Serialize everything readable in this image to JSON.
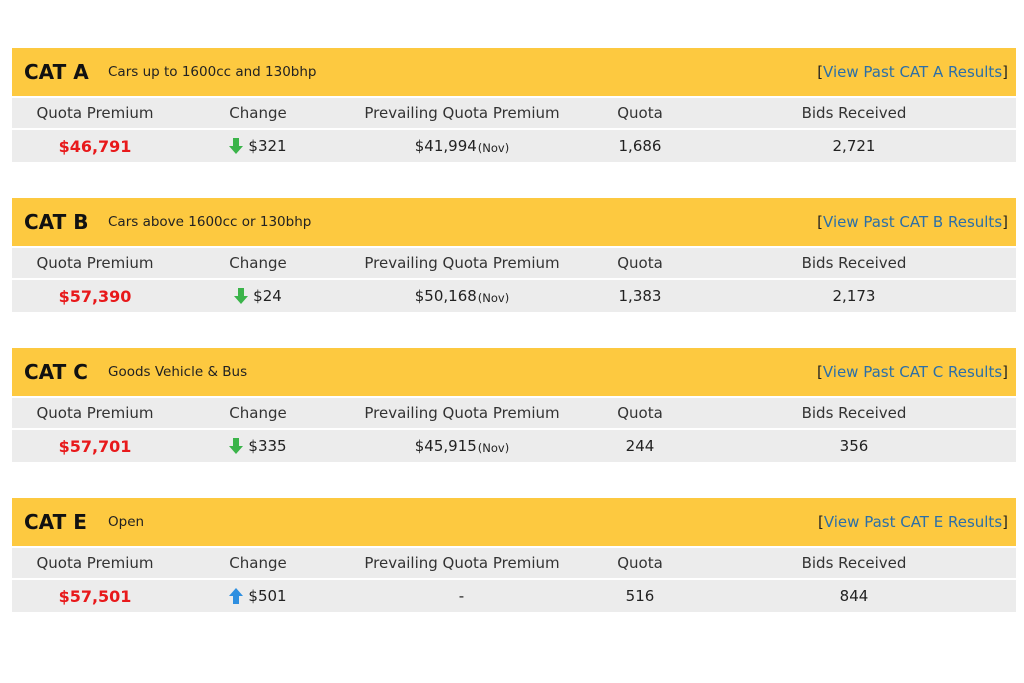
{
  "columns": {
    "quota_premium": "Quota Premium",
    "change": "Change",
    "prevailing": "Prevailing Quota Premium",
    "quota": "Quota",
    "bids": "Bids Received"
  },
  "colors": {
    "header_bg": "#fdc940",
    "row_bg": "#ececec",
    "premium": "#e8191b",
    "down": "#3bb44a",
    "up": "#2e8fe0",
    "link": "#2b6fa8"
  },
  "categories": [
    {
      "name": "CAT A",
      "desc": "Cars up to 1600cc and 130bhp",
      "link": "View Past CAT A Results",
      "premium": "$46,791",
      "change_dir": "down",
      "change_icon": "arrow-down-icon",
      "change": "$321",
      "prevailing": "$41,994",
      "prevailing_suffix": "(Nov)",
      "quota": "1,686",
      "bids": "2,721"
    },
    {
      "name": "CAT B",
      "desc": "Cars above 1600cc or 130bhp",
      "link": "View Past CAT B Results",
      "premium": "$57,390",
      "change_dir": "down",
      "change_icon": "arrow-down-icon",
      "change": "$24",
      "prevailing": "$50,168",
      "prevailing_suffix": "(Nov)",
      "quota": "1,383",
      "bids": "2,173"
    },
    {
      "name": "CAT C",
      "desc": "Goods Vehicle & Bus",
      "link": "View Past CAT C Results",
      "premium": "$57,701",
      "change_dir": "down",
      "change_icon": "arrow-down-icon",
      "change": "$335",
      "prevailing": "$45,915",
      "prevailing_suffix": "(Nov)",
      "quota": "244",
      "bids": "356"
    },
    {
      "name": "CAT E",
      "desc": "Open",
      "link": "View Past CAT E Results",
      "premium": "$57,501",
      "change_dir": "up",
      "change_icon": "arrow-up-icon",
      "change": "$501",
      "prevailing": "-",
      "prevailing_suffix": "",
      "quota": "516",
      "bids": "844"
    }
  ]
}
